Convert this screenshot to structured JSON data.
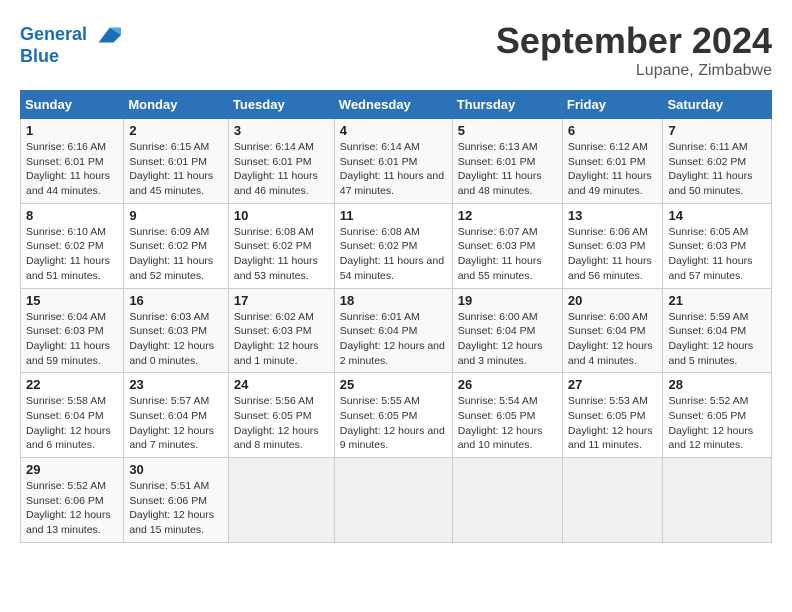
{
  "header": {
    "logo_line1": "General",
    "logo_line2": "Blue",
    "month_title": "September 2024",
    "location": "Lupane, Zimbabwe"
  },
  "weekdays": [
    "Sunday",
    "Monday",
    "Tuesday",
    "Wednesday",
    "Thursday",
    "Friday",
    "Saturday"
  ],
  "weeks": [
    [
      {
        "day": "1",
        "sunrise": "6:16 AM",
        "sunset": "6:01 PM",
        "daylight": "11 hours and 44 minutes."
      },
      {
        "day": "2",
        "sunrise": "6:15 AM",
        "sunset": "6:01 PM",
        "daylight": "11 hours and 45 minutes."
      },
      {
        "day": "3",
        "sunrise": "6:14 AM",
        "sunset": "6:01 PM",
        "daylight": "11 hours and 46 minutes."
      },
      {
        "day": "4",
        "sunrise": "6:14 AM",
        "sunset": "6:01 PM",
        "daylight": "11 hours and 47 minutes."
      },
      {
        "day": "5",
        "sunrise": "6:13 AM",
        "sunset": "6:01 PM",
        "daylight": "11 hours and 48 minutes."
      },
      {
        "day": "6",
        "sunrise": "6:12 AM",
        "sunset": "6:01 PM",
        "daylight": "11 hours and 49 minutes."
      },
      {
        "day": "7",
        "sunrise": "6:11 AM",
        "sunset": "6:02 PM",
        "daylight": "11 hours and 50 minutes."
      }
    ],
    [
      {
        "day": "8",
        "sunrise": "6:10 AM",
        "sunset": "6:02 PM",
        "daylight": "11 hours and 51 minutes."
      },
      {
        "day": "9",
        "sunrise": "6:09 AM",
        "sunset": "6:02 PM",
        "daylight": "11 hours and 52 minutes."
      },
      {
        "day": "10",
        "sunrise": "6:08 AM",
        "sunset": "6:02 PM",
        "daylight": "11 hours and 53 minutes."
      },
      {
        "day": "11",
        "sunrise": "6:08 AM",
        "sunset": "6:02 PM",
        "daylight": "11 hours and 54 minutes."
      },
      {
        "day": "12",
        "sunrise": "6:07 AM",
        "sunset": "6:03 PM",
        "daylight": "11 hours and 55 minutes."
      },
      {
        "day": "13",
        "sunrise": "6:06 AM",
        "sunset": "6:03 PM",
        "daylight": "11 hours and 56 minutes."
      },
      {
        "day": "14",
        "sunrise": "6:05 AM",
        "sunset": "6:03 PM",
        "daylight": "11 hours and 57 minutes."
      }
    ],
    [
      {
        "day": "15",
        "sunrise": "6:04 AM",
        "sunset": "6:03 PM",
        "daylight": "11 hours and 59 minutes."
      },
      {
        "day": "16",
        "sunrise": "6:03 AM",
        "sunset": "6:03 PM",
        "daylight": "12 hours and 0 minutes."
      },
      {
        "day": "17",
        "sunrise": "6:02 AM",
        "sunset": "6:03 PM",
        "daylight": "12 hours and 1 minute."
      },
      {
        "day": "18",
        "sunrise": "6:01 AM",
        "sunset": "6:04 PM",
        "daylight": "12 hours and 2 minutes."
      },
      {
        "day": "19",
        "sunrise": "6:00 AM",
        "sunset": "6:04 PM",
        "daylight": "12 hours and 3 minutes."
      },
      {
        "day": "20",
        "sunrise": "6:00 AM",
        "sunset": "6:04 PM",
        "daylight": "12 hours and 4 minutes."
      },
      {
        "day": "21",
        "sunrise": "5:59 AM",
        "sunset": "6:04 PM",
        "daylight": "12 hours and 5 minutes."
      }
    ],
    [
      {
        "day": "22",
        "sunrise": "5:58 AM",
        "sunset": "6:04 PM",
        "daylight": "12 hours and 6 minutes."
      },
      {
        "day": "23",
        "sunrise": "5:57 AM",
        "sunset": "6:04 PM",
        "daylight": "12 hours and 7 minutes."
      },
      {
        "day": "24",
        "sunrise": "5:56 AM",
        "sunset": "6:05 PM",
        "daylight": "12 hours and 8 minutes."
      },
      {
        "day": "25",
        "sunrise": "5:55 AM",
        "sunset": "6:05 PM",
        "daylight": "12 hours and 9 minutes."
      },
      {
        "day": "26",
        "sunrise": "5:54 AM",
        "sunset": "6:05 PM",
        "daylight": "12 hours and 10 minutes."
      },
      {
        "day": "27",
        "sunrise": "5:53 AM",
        "sunset": "6:05 PM",
        "daylight": "12 hours and 11 minutes."
      },
      {
        "day": "28",
        "sunrise": "5:52 AM",
        "sunset": "6:05 PM",
        "daylight": "12 hours and 12 minutes."
      }
    ],
    [
      {
        "day": "29",
        "sunrise": "5:52 AM",
        "sunset": "6:06 PM",
        "daylight": "12 hours and 13 minutes."
      },
      {
        "day": "30",
        "sunrise": "5:51 AM",
        "sunset": "6:06 PM",
        "daylight": "12 hours and 15 minutes."
      },
      null,
      null,
      null,
      null,
      null
    ]
  ]
}
